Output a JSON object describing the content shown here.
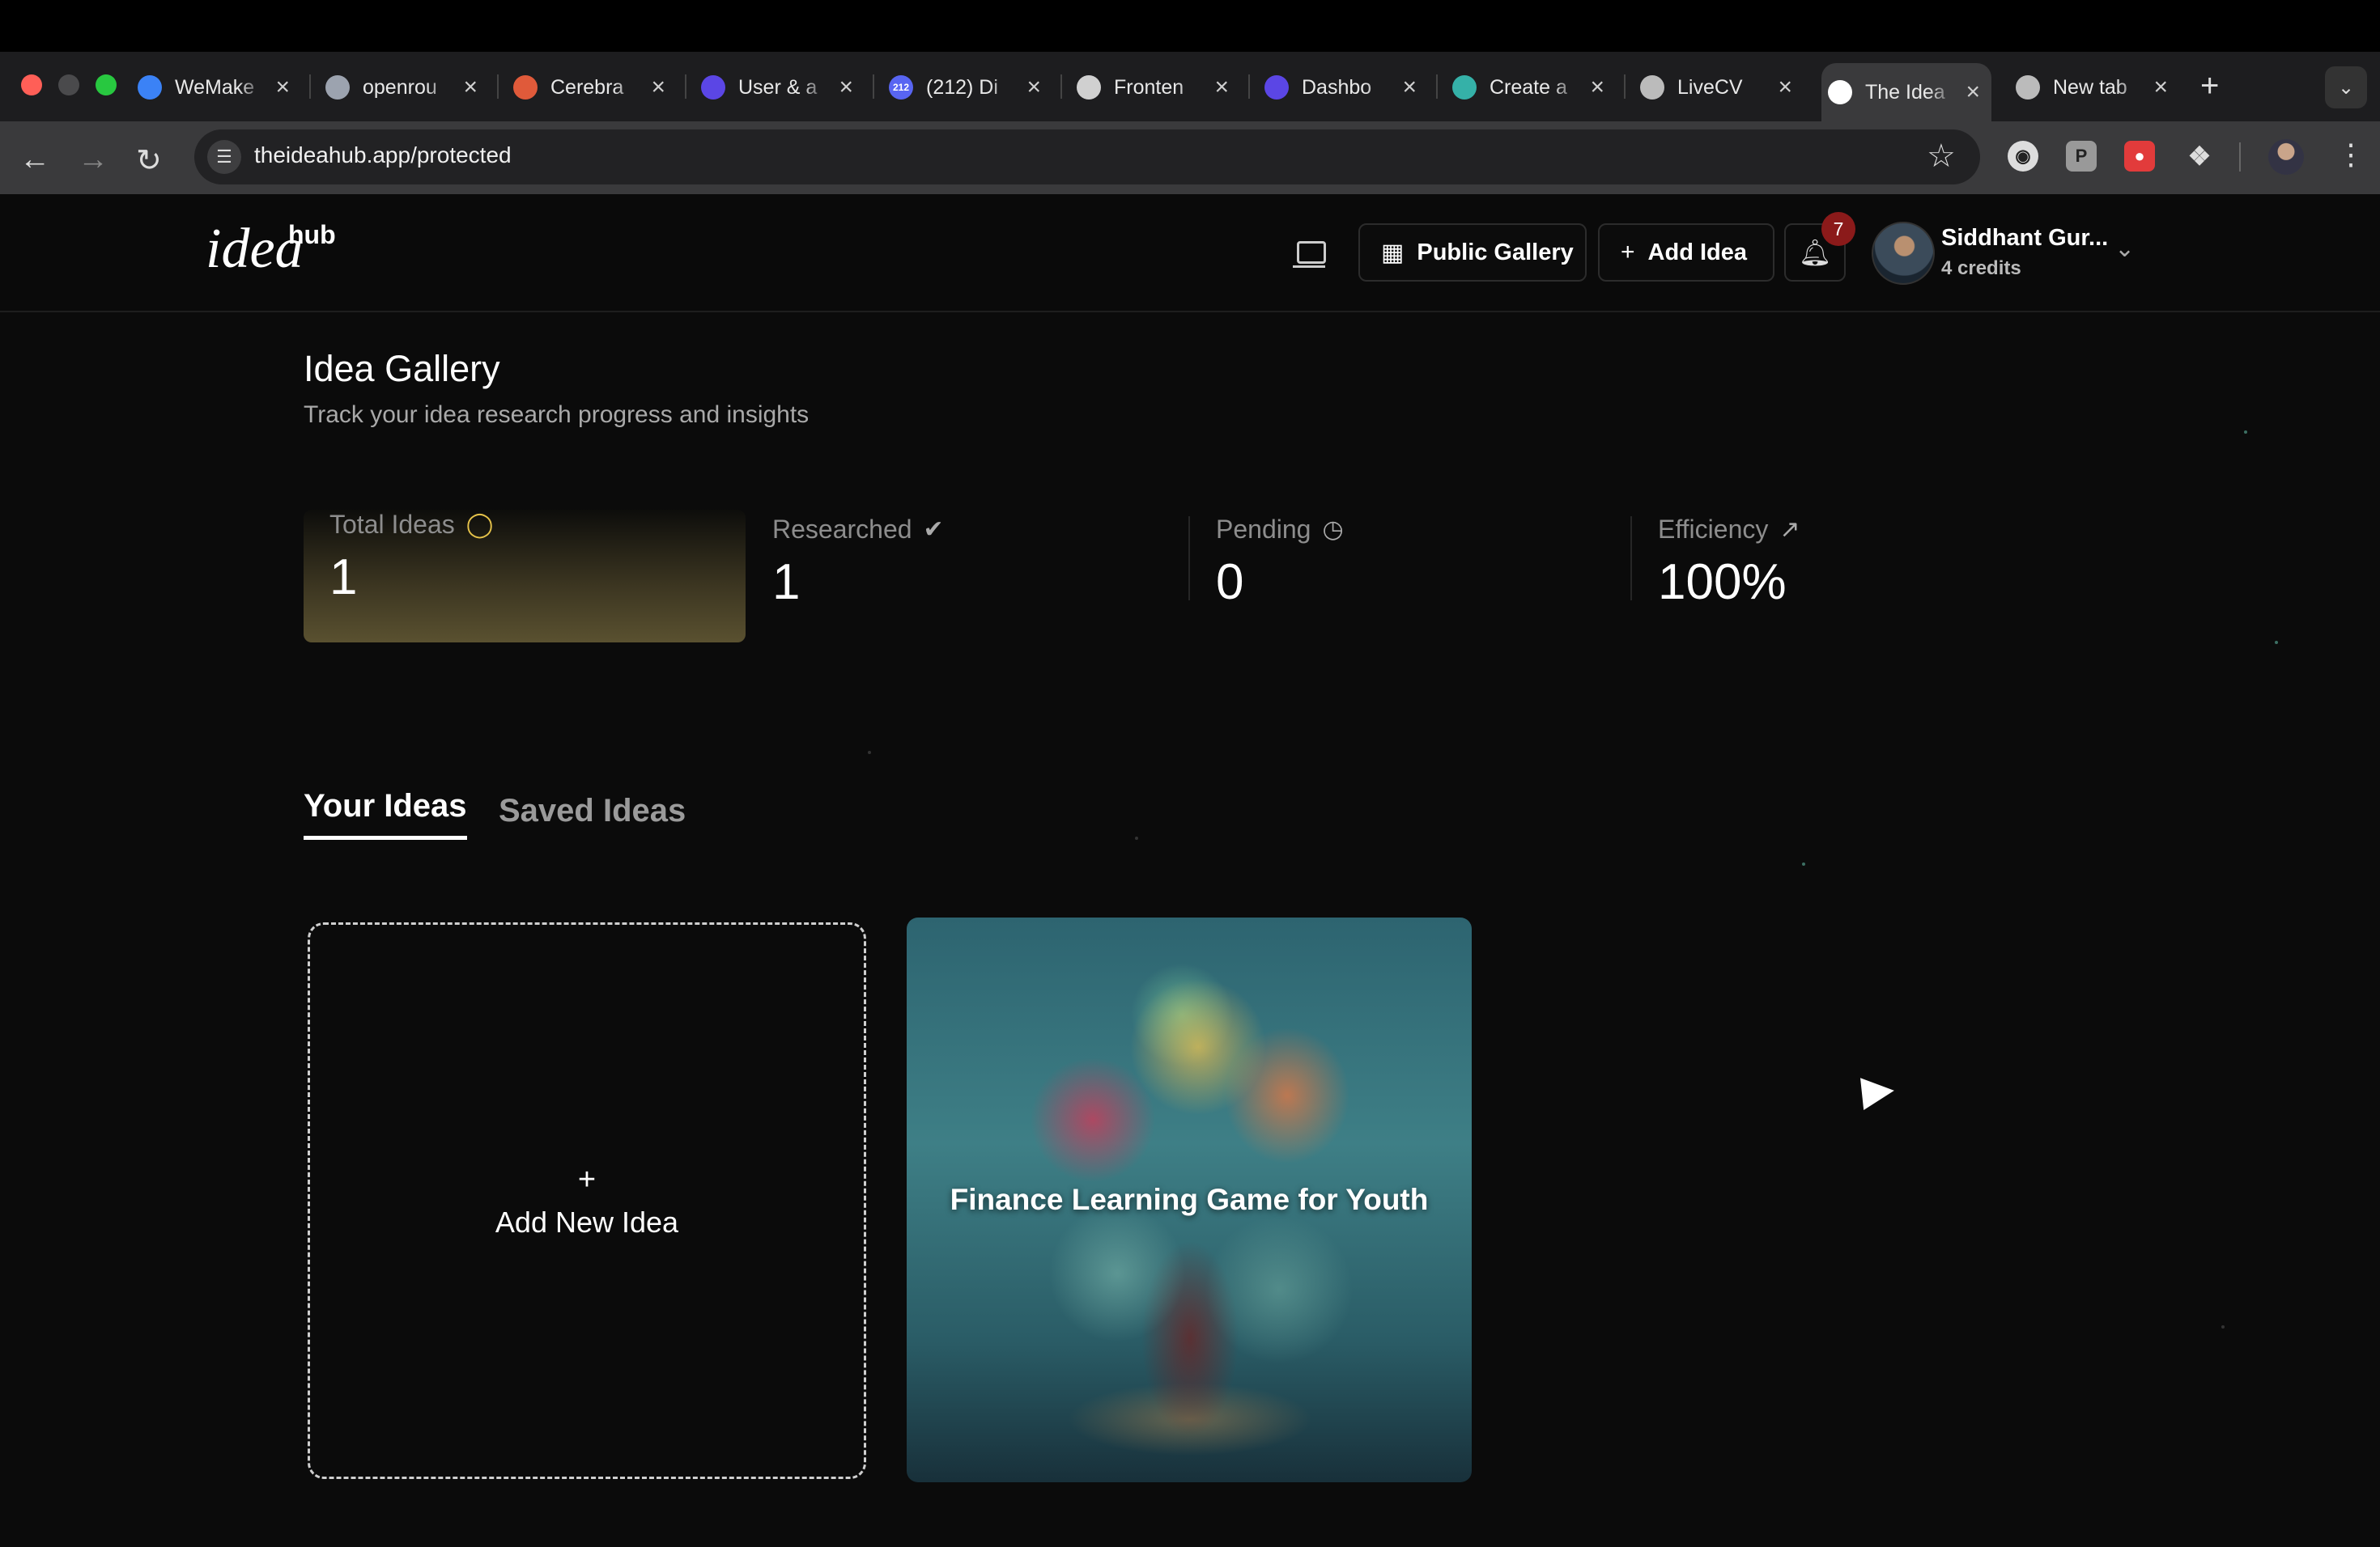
{
  "browser": {
    "tabs": [
      {
        "title": "WeMake",
        "icon": "wemake-icon",
        "color": "#3b82f6"
      },
      {
        "title": "openrou",
        "icon": "openrouter-icon",
        "color": "#9ca3af"
      },
      {
        "title": "Cerebra",
        "icon": "cerebras-icon",
        "color": "#e05a3a"
      },
      {
        "title": "User & a",
        "icon": "clerk-icon",
        "color": "#5b46e5"
      },
      {
        "title": "(212) Di",
        "icon": "discord-icon",
        "color": "#5865f2",
        "badge": "212"
      },
      {
        "title": "Fronten",
        "icon": "openai-icon",
        "color": "#d0d0d0"
      },
      {
        "title": "Dashbo",
        "icon": "clerk-icon",
        "color": "#5b46e5"
      },
      {
        "title": "Create a",
        "icon": "diamond-icon",
        "color": "#35b1a8"
      },
      {
        "title": "LiveCV",
        "icon": "globe-icon",
        "color": "#bbbbbb"
      },
      {
        "title": "The Idea",
        "icon": "ideahub-icon",
        "color": "#ffffff",
        "active": true
      },
      {
        "title": "New tab",
        "icon": "chrome-icon",
        "color": "#bbbbbb"
      }
    ],
    "url": "theideahub.app/protected"
  },
  "header": {
    "logo_main": "idea",
    "logo_sup": "hub",
    "public_gallery_label": "Public Gallery",
    "add_idea_label": "Add Idea",
    "notification_count": "7",
    "user_name": "Siddhant Gur...",
    "user_credits": "4 credits"
  },
  "main": {
    "title": "Idea Gallery",
    "subtitle": "Track your idea research progress and insights",
    "stats": [
      {
        "label": "Total Ideas",
        "value": "1",
        "icon": "lightbulb-icon"
      },
      {
        "label": "Researched",
        "value": "1",
        "icon": "check-circle-icon"
      },
      {
        "label": "Pending",
        "value": "0",
        "icon": "clock-icon"
      },
      {
        "label": "Efficiency",
        "value": "100%",
        "icon": "trending-up-icon"
      }
    ],
    "tabs": [
      {
        "label": "Your Ideas",
        "active": true
      },
      {
        "label": "Saved Ideas",
        "active": false
      }
    ],
    "add_card": {
      "plus": "+",
      "label": "Add New Idea"
    },
    "ideas": [
      {
        "title": "Finance Learning Game for Youth"
      }
    ]
  },
  "colors": {
    "accent_gold": "#e6c34a",
    "badge_red": "#8b1a1a",
    "background": "#0b0b0b"
  }
}
